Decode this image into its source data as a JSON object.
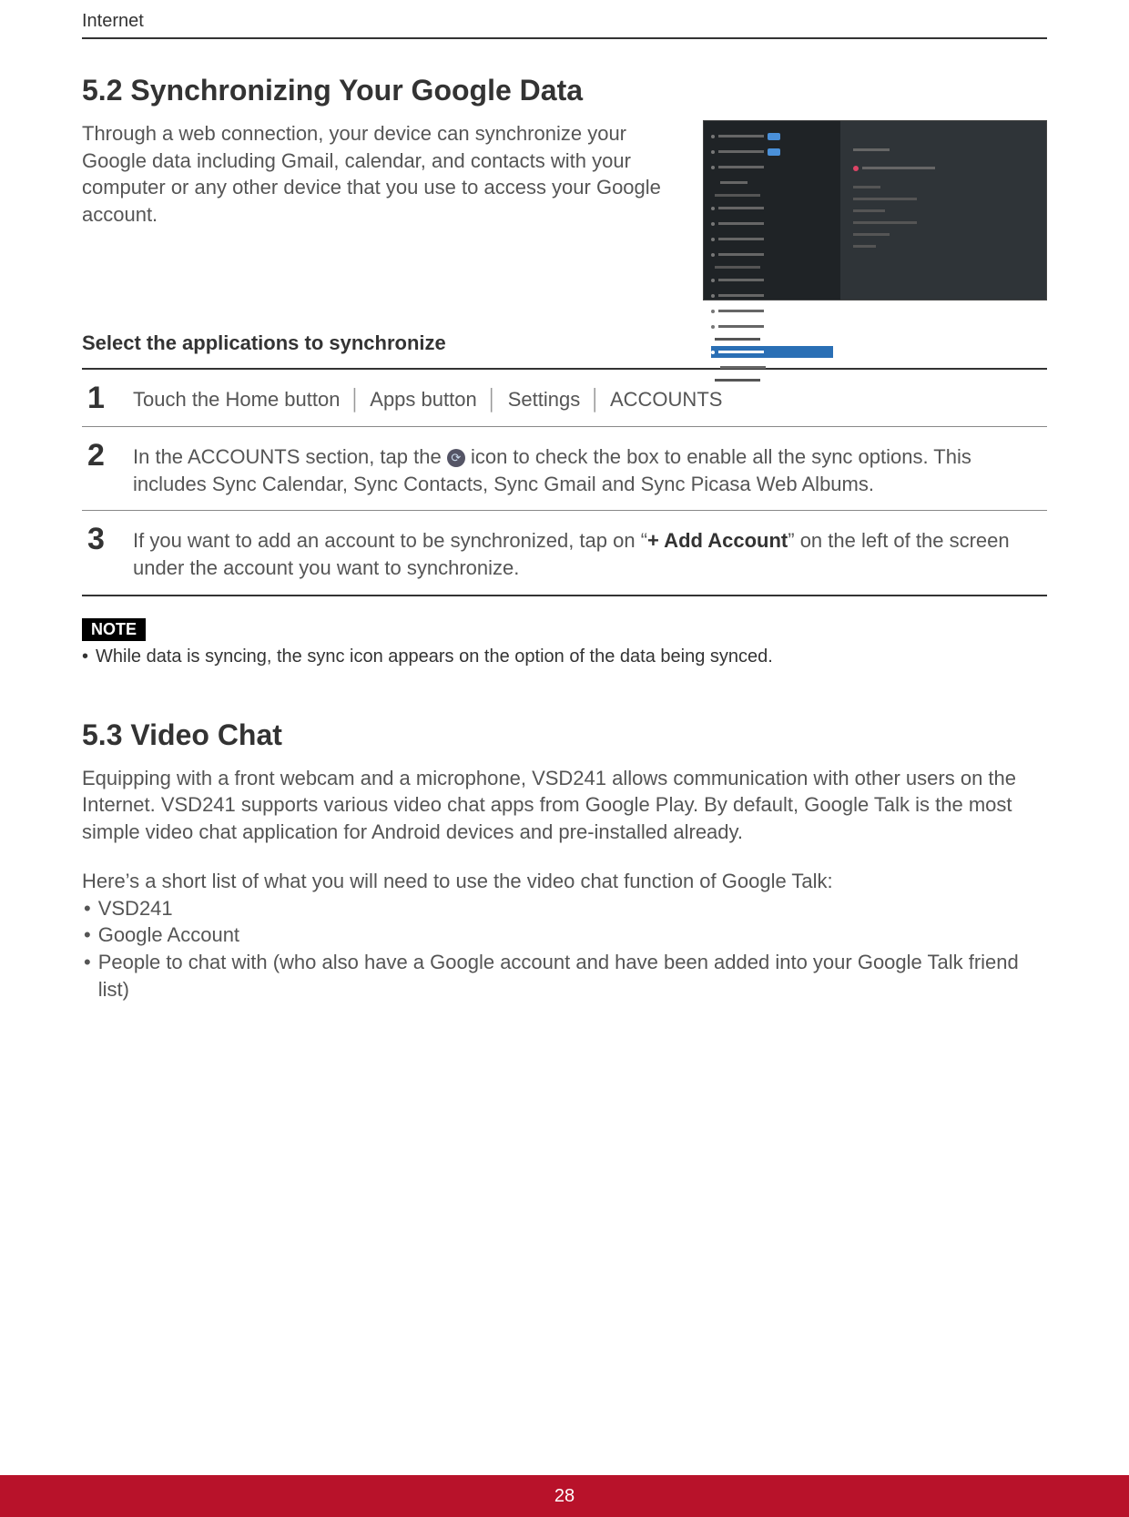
{
  "header": "Internet",
  "section52": {
    "title": "5.2  Synchronizing Your Google Data",
    "intro": "Through a web connection, your device can synchronize your Google data including Gmail, calendar, and contacts with your computer or any other device that you use to access your Google account.",
    "subhead": "Select the applications to synchronize",
    "steps": [
      {
        "num": "1",
        "parts": [
          "Touch the Home button",
          "Apps button",
          "Settings",
          "ACCOUNTS"
        ]
      },
      {
        "num": "2",
        "pre": "In the ACCOUNTS section, tap the ",
        "post": " icon to check the box to enable all the sync options. This includes Sync Calendar, Sync Contacts, Sync Gmail and Sync Picasa Web Albums."
      },
      {
        "num": "3",
        "pre": "If you want to add an account to be synchronized, tap on “",
        "bold": "+ Add Account",
        "post": "” on the left of the screen under the account you want to synchronize."
      }
    ],
    "note_label": "NOTE",
    "note_text": "While data is syncing, the sync icon appears on the option of the data being synced."
  },
  "section53": {
    "title": "5.3  Video Chat",
    "para": "Equipping with a front webcam and a microphone, VSD241 allows communication with other users on the Internet. VSD241 supports various video chat apps from Google Play. By default, Google Talk is the most simple video chat application for Android devices and pre-installed already.",
    "list_intro": "Here’s a short list of what you will need to use the video chat function of Google Talk:",
    "items": [
      "VSD241",
      "Google Account",
      "People to chat with (who also have a Google account and have been added into your Google Talk friend list)"
    ]
  },
  "page_number": "28"
}
